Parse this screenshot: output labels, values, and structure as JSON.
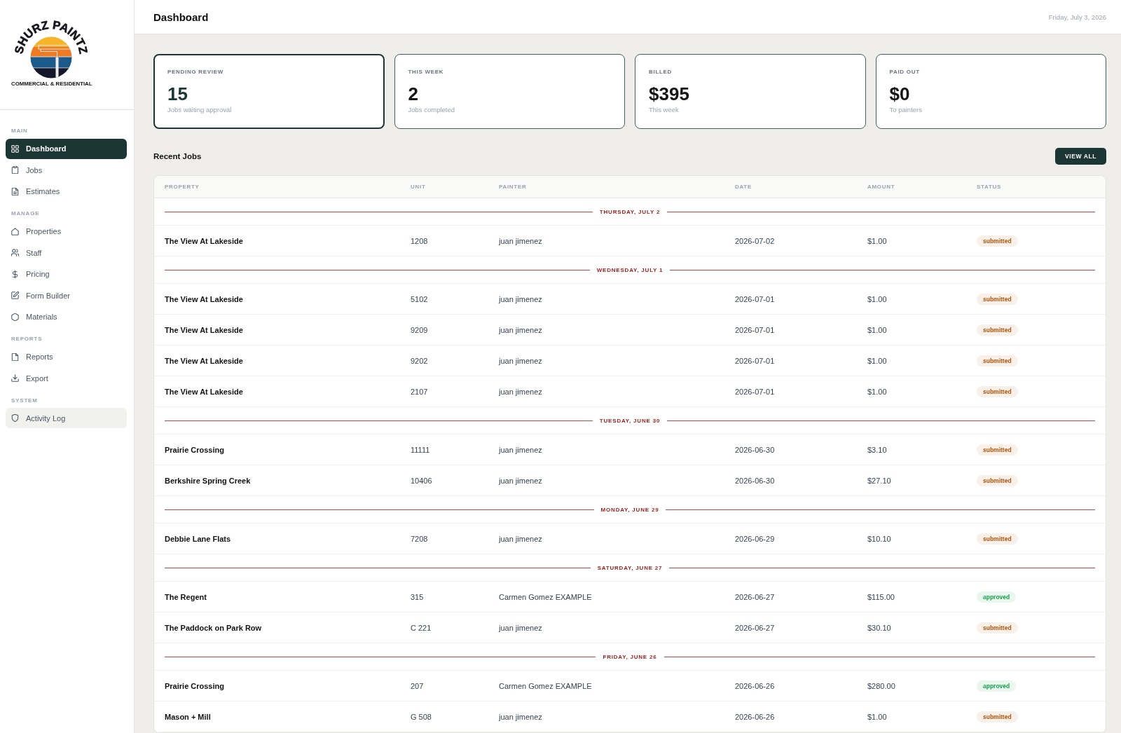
{
  "sidebar": {
    "logo": {
      "wordmark": "SHURZ PAINTZ",
      "tagline": "COMMERCIAL & RESIDENTIAL"
    },
    "sections": [
      {
        "label": "MAIN",
        "items": [
          {
            "label": "Dashboard",
            "selected": true,
            "hovered": false
          },
          {
            "label": "Jobs",
            "selected": false,
            "hovered": false
          },
          {
            "label": "Estimates",
            "selected": false,
            "hovered": false
          }
        ]
      },
      {
        "label": "MANAGE",
        "items": [
          {
            "label": "Properties",
            "selected": false,
            "hovered": false
          },
          {
            "label": "Staff",
            "selected": false,
            "hovered": false
          },
          {
            "label": "Pricing",
            "selected": false,
            "hovered": false
          },
          {
            "label": "Form Builder",
            "selected": false,
            "hovered": false
          },
          {
            "label": "Materials",
            "selected": false,
            "hovered": false
          }
        ]
      },
      {
        "label": "REPORTS",
        "items": [
          {
            "label": "Reports",
            "selected": false,
            "hovered": false
          },
          {
            "label": "Export",
            "selected": false,
            "hovered": false
          }
        ]
      },
      {
        "label": "SYSTEM",
        "items": [
          {
            "label": "Activity Log",
            "selected": false,
            "hovered": true
          }
        ]
      }
    ]
  },
  "header": {
    "title": "Dashboard",
    "date": "Friday, July 3, 2026"
  },
  "stats": [
    {
      "label": "PENDING REVIEW",
      "value": "15",
      "caption": "Jobs waiting approval",
      "selected": true
    },
    {
      "label": "THIS WEEK",
      "value": "2",
      "caption": "Jobs completed",
      "selected": false
    },
    {
      "label": "BILLED",
      "value": "$395",
      "caption": "This week",
      "selected": false
    },
    {
      "label": "PAID OUT",
      "value": "$0",
      "caption": "To painters",
      "selected": false
    }
  ],
  "recent_jobs": {
    "title": "Recent Jobs",
    "button": "VIEW ALL",
    "table": {
      "columns": [
        "PROPERTY",
        "UNIT",
        "PAINTER",
        "DATE",
        "AMOUNT",
        "STATUS"
      ],
      "groups": [
        {
          "label": "THURSDAY, JULY 2",
          "rows": [
            {
              "property": "The View At Lakeside",
              "unit": "1208",
              "painter": "juan jimenez",
              "date": "2026-07-02",
              "amount": "$1.00",
              "status": {
                "label": "submitted",
                "color": "#b45309"
              }
            }
          ]
        },
        {
          "label": "WEDNESDAY, JULY 1",
          "rows": [
            {
              "property": "The View At Lakeside",
              "unit": "5102",
              "painter": "juan jimenez",
              "date": "2026-07-01",
              "amount": "$1.00",
              "status": {
                "label": "submitted",
                "color": "#b45309"
              }
            },
            {
              "property": "The View At Lakeside",
              "unit": "9209",
              "painter": "juan jimenez",
              "date": "2026-07-01",
              "amount": "$1.00",
              "status": {
                "label": "submitted",
                "color": "#b45309"
              }
            },
            {
              "property": "The View At Lakeside",
              "unit": "9202",
              "painter": "juan jimenez",
              "date": "2026-07-01",
              "amount": "$1.00",
              "status": {
                "label": "submitted",
                "color": "#b45309"
              }
            },
            {
              "property": "The View At Lakeside",
              "unit": "2107",
              "painter": "juan jimenez",
              "date": "2026-07-01",
              "amount": "$1.00",
              "status": {
                "label": "submitted",
                "color": "#b45309"
              }
            }
          ]
        },
        {
          "label": "TUESDAY, JUNE 30",
          "rows": [
            {
              "property": "Prairie Crossing",
              "unit": "11111",
              "painter": "juan jimenez",
              "date": "2026-06-30",
              "amount": "$3.10",
              "status": {
                "label": "submitted",
                "color": "#b45309"
              }
            },
            {
              "property": "Berkshire Spring Creek",
              "unit": "10406",
              "painter": "juan jimenez",
              "date": "2026-06-30",
              "amount": "$27.10",
              "status": {
                "label": "submitted",
                "color": "#b45309"
              }
            }
          ]
        },
        {
          "label": "MONDAY, JUNE 29",
          "rows": [
            {
              "property": "Debbie Lane Flats",
              "unit": "7208",
              "painter": "juan jimenez",
              "date": "2026-06-29",
              "amount": "$10.10",
              "status": {
                "label": "submitted",
                "color": "#b45309"
              }
            }
          ]
        },
        {
          "label": "SATURDAY, JUNE 27",
          "rows": [
            {
              "property": "The Regent",
              "unit": "315",
              "painter": "Carmen Gomez EXAMPLE",
              "date": "2026-06-27",
              "amount": "$115.00",
              "status": {
                "label": "approved",
                "color": "#16a34a"
              }
            },
            {
              "property": "The Paddock on Park Row",
              "unit": "C 221",
              "painter": "juan jimenez",
              "date": "2026-06-27",
              "amount": "$30.10",
              "status": {
                "label": "submitted",
                "color": "#b45309"
              }
            }
          ]
        },
        {
          "label": "FRIDAY, JUNE 26",
          "rows": [
            {
              "property": "Prairie Crossing",
              "unit": "207",
              "painter": "Carmen Gomez EXAMPLE",
              "date": "2026-06-26",
              "amount": "$280.00",
              "status": {
                "label": "approved",
                "color": "#16a34a"
              }
            },
            {
              "property": "Mason + Mill",
              "unit": "G 508",
              "painter": "juan jimenez",
              "date": "2026-06-26",
              "amount": "$1.00",
              "status": {
                "label": "submitted",
                "color": "#b45309"
              }
            }
          ]
        }
      ]
    }
  }
}
